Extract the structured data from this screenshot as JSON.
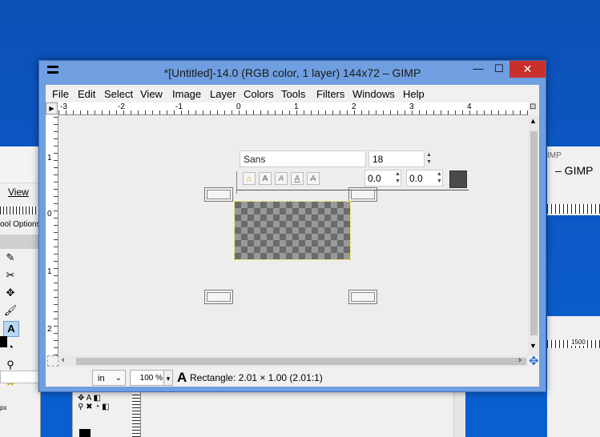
{
  "window": {
    "title": "*[Untitled]-14.0 (RGB color, 1 layer) 144x72 – GIMP",
    "min_glyph": "—",
    "max_glyph": "☐",
    "close_glyph": "✕"
  },
  "menu": [
    {
      "label": "File"
    },
    {
      "label": "Edit"
    },
    {
      "label": "Select"
    },
    {
      "label": "View"
    },
    {
      "label": "Image"
    },
    {
      "label": "Layer"
    },
    {
      "label": "Colors"
    },
    {
      "label": "Tools"
    },
    {
      "label": "Filters"
    },
    {
      "label": "Windows"
    },
    {
      "label": "Help"
    }
  ],
  "hruler_ticks": [
    "-3",
    "-2",
    "-1",
    "0",
    "1",
    "2",
    "3",
    "4"
  ],
  "vruler_ticks": [
    "1",
    "0",
    "1",
    "2"
  ],
  "text_toolbox": {
    "font": "Sans",
    "size": "18",
    "baseline": "0.0",
    "kerning": "0.0",
    "style_buttons": [
      "A",
      "A",
      "A",
      "A"
    ],
    "color": "#4a4a4a"
  },
  "status": {
    "unit": "in",
    "zoom": "100 %",
    "message": "Rectangle: 2.01 × 1.00  (2.01:1)"
  },
  "background_left": {
    "menu_view": "View",
    "tool_options": "ool Options",
    "unit": "px"
  },
  "background_right": {
    "title_fragment": "– GIMP",
    "title_fragment2": "IMP",
    "ruler_label": "1500"
  }
}
